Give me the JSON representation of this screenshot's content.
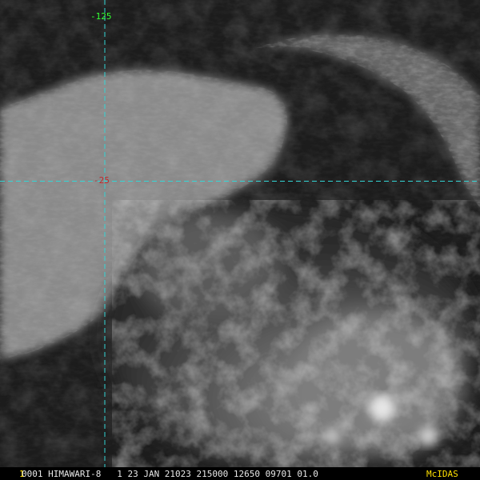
{
  "colors": {
    "gridline": "#33d6d6",
    "lon_label": "#33ff33",
    "lat_label": "#c0282a",
    "frame_number": "#ffe000",
    "text": "#e8e8e8",
    "mcidas": "#ffe000"
  },
  "grid": {
    "longitude_label": "-125",
    "latitude_label": "-25"
  },
  "status": {
    "frame_number": "1",
    "text": "0001 HIMAWARI-8   1 23 JAN 21023 215000 12650 09701 01.0",
    "product": "McIDAS"
  }
}
